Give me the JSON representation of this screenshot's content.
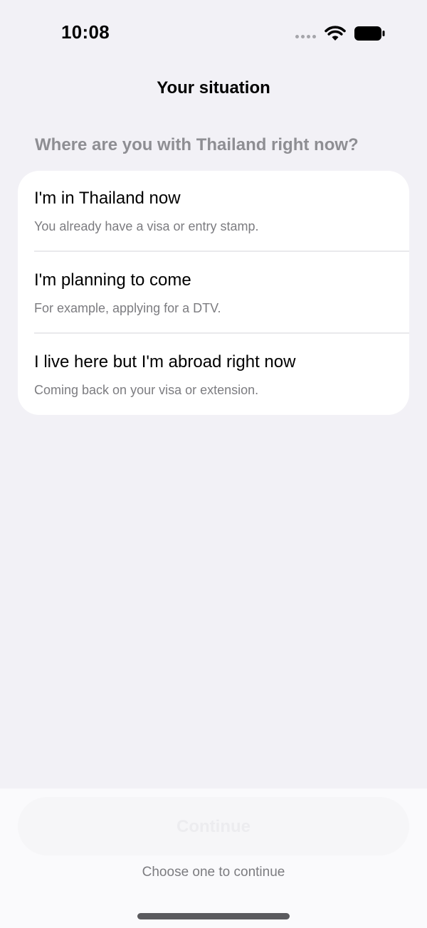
{
  "status_bar": {
    "time": "10:08",
    "signal_icon": "signal-dots-icon",
    "wifi_icon": "wifi-icon",
    "battery_icon": "battery-icon"
  },
  "nav": {
    "title": "Your situation"
  },
  "question": {
    "header": "Where are you with Thailand right now?"
  },
  "options": [
    {
      "title": "I'm in Thailand now",
      "subtitle": "You already have a visa or entry stamp."
    },
    {
      "title": "I'm planning to come",
      "subtitle": "For example, applying for a DTV."
    },
    {
      "title": "I live here but I'm abroad right now",
      "subtitle": "Coming back on your visa or extension."
    }
  ],
  "footer": {
    "continue_label": "Continue",
    "continue_state": "disabled",
    "hint": "Choose one to continue"
  },
  "colors": {
    "background": "#f2f1f6",
    "card": "#ffffff",
    "secondary_text": "#8e8e93"
  }
}
